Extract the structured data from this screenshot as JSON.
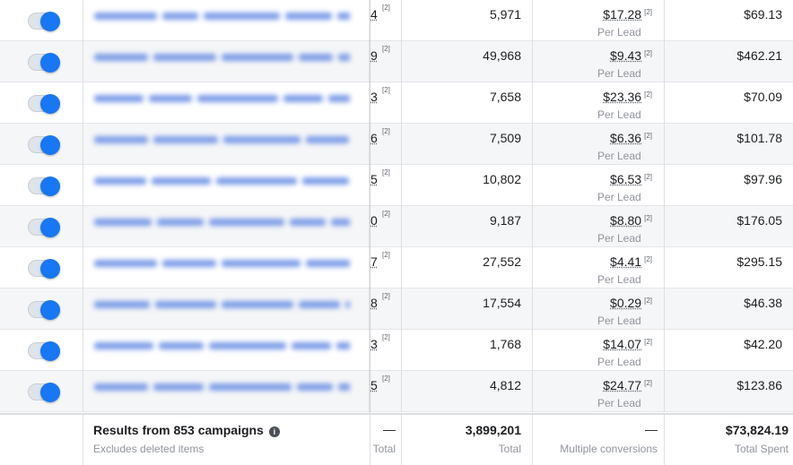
{
  "rows": [
    {
      "results_frag": "4",
      "reach": "5,971",
      "cost": "$17.28",
      "cost_sub": "Per Lead",
      "spent": "$69.13",
      "sup": "[2]"
    },
    {
      "results_frag": "9",
      "reach": "49,968",
      "cost": "$9.43",
      "cost_sub": "Per Lead",
      "spent": "$462.21",
      "sup": "[2]"
    },
    {
      "results_frag": "3",
      "reach": "7,658",
      "cost": "$23.36",
      "cost_sub": "Per Lead",
      "spent": "$70.09",
      "sup": "[2]"
    },
    {
      "results_frag": "6",
      "reach": "7,509",
      "cost": "$6.36",
      "cost_sub": "Per Lead",
      "spent": "$101.78",
      "sup": "[2]"
    },
    {
      "results_frag": "5",
      "reach": "10,802",
      "cost": "$6.53",
      "cost_sub": "Per Lead",
      "spent": "$97.96",
      "sup": "[2]"
    },
    {
      "results_frag": "0",
      "reach": "9,187",
      "cost": "$8.80",
      "cost_sub": "Per Lead",
      "spent": "$176.05",
      "sup": "[2]"
    },
    {
      "results_frag": "7",
      "reach": "27,552",
      "cost": "$4.41",
      "cost_sub": "Per Lead",
      "spent": "$295.15",
      "sup": "[2]"
    },
    {
      "results_frag": "8",
      "reach": "17,554",
      "cost": "$0.29",
      "cost_sub": "Per Lead",
      "spent": "$46.38",
      "sup": "[2]"
    },
    {
      "results_frag": "3",
      "reach": "1,768",
      "cost": "$14.07",
      "cost_sub": "Per Lead",
      "spent": "$42.20",
      "sup": "[2]"
    },
    {
      "results_frag": "5",
      "reach": "4,812",
      "cost": "$24.77",
      "cost_sub": "Per Lead",
      "spent": "$123.86",
      "sup": "[2]"
    }
  ],
  "footer": {
    "title": "Results from 853 campaigns",
    "subtitle": "Excludes deleted items",
    "results_value": "—",
    "results_label": "Total",
    "reach_value": "3,899,201",
    "reach_label": "Total",
    "cost_value": "—",
    "cost_label": "Multiple conversions",
    "spent_value": "$73,824.19",
    "spent_label": "Total Spent",
    "info_icon": "info-icon"
  },
  "colors": {
    "toggle_on": "#1877f2",
    "row_alt": "#f5f6f7",
    "muted_text": "#90949c"
  }
}
